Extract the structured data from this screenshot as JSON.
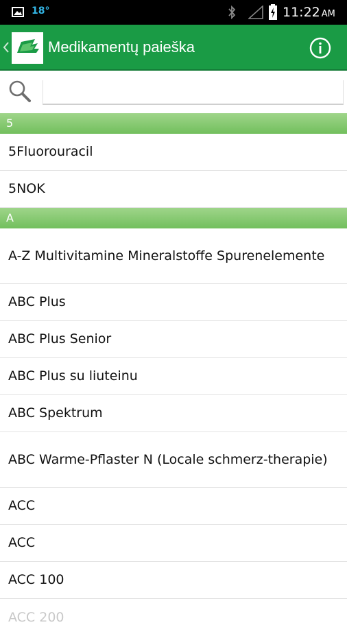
{
  "status_bar": {
    "temperature": "18°",
    "time": "11:22",
    "ampm": "AM",
    "icons": [
      "gallery-icon",
      "bluetooth-icon",
      "signal-icon",
      "battery-charging-icon"
    ]
  },
  "action_bar": {
    "title": "Medikamentų paieška",
    "icons": [
      "up-chevron-icon",
      "app-logo-icon",
      "info-icon"
    ],
    "color": "#1a9b45"
  },
  "search": {
    "placeholder": "",
    "value": "",
    "icon": "search-icon"
  },
  "sections": [
    {
      "header": "5",
      "items": [
        "5Fluorouracil",
        "5NOK"
      ]
    },
    {
      "header": "A",
      "items": [
        "A-Z Multivitamine Mineralstoffe Spurenelemente",
        "ABC Plus",
        "ABC Plus Senior",
        "ABC Plus su liuteinu",
        "ABC Spektrum",
        "ABC Warme-Pflaster N (Locale schmerz-therapie)",
        "ACC",
        "ACC",
        "ACC 100",
        "ACC 200"
      ]
    }
  ],
  "colors": {
    "section_header": "#7cc465",
    "status_bar": "#000000",
    "temperature": "#33b5e5"
  }
}
